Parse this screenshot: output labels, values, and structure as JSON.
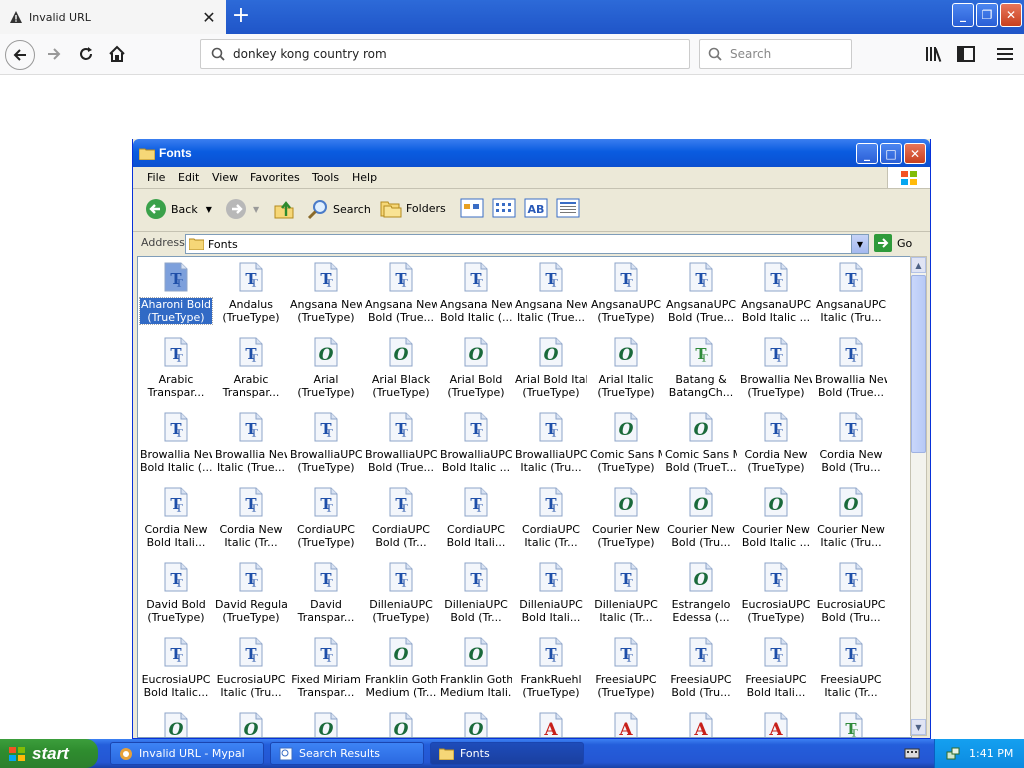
{
  "browser": {
    "tab_title": "Invalid URL",
    "url": "donkey kong country rom",
    "search_placeholder": "Search"
  },
  "explorer": {
    "title": "Fonts",
    "menus": [
      "File",
      "Edit",
      "View",
      "Favorites",
      "Tools",
      "Help"
    ],
    "toolbar": {
      "back": "Back",
      "search": "Search",
      "folders": "Folders"
    },
    "address_label": "Address",
    "address_value": "Fonts",
    "go": "Go",
    "fonts": [
      {
        "n1": "Aharoni Bold",
        "n2": "(TrueType)",
        "t": "T"
      },
      {
        "n1": "Andalus",
        "n2": "(TrueType)",
        "t": "T"
      },
      {
        "n1": "Angsana New",
        "n2": "(TrueType)",
        "t": "T"
      },
      {
        "n1": "Angsana New",
        "n2": "Bold (True...",
        "t": "T"
      },
      {
        "n1": "Angsana New",
        "n2": "Bold Italic (...",
        "t": "T"
      },
      {
        "n1": "Angsana New",
        "n2": "Italic (True...",
        "t": "T"
      },
      {
        "n1": "AngsanaUPC",
        "n2": "(TrueType)",
        "t": "T"
      },
      {
        "n1": "AngsanaUPC",
        "n2": "Bold (True...",
        "t": "T"
      },
      {
        "n1": "AngsanaUPC",
        "n2": "Bold Italic ...",
        "t": "T"
      },
      {
        "n1": "AngsanaUPC",
        "n2": "Italic (Tru...",
        "t": "T"
      },
      {
        "n1": "Arabic",
        "n2": "Transpar...",
        "t": "T"
      },
      {
        "n1": "Arabic",
        "n2": "Transpar...",
        "t": "T"
      },
      {
        "n1": "Arial",
        "n2": "(TrueType)",
        "t": "O"
      },
      {
        "n1": "Arial Black",
        "n2": "(TrueType)",
        "t": "O"
      },
      {
        "n1": "Arial Bold",
        "n2": "(TrueType)",
        "t": "O"
      },
      {
        "n1": "Arial Bold Italic",
        "n2": "(TrueType)",
        "t": "O"
      },
      {
        "n1": "Arial Italic",
        "n2": "(TrueType)",
        "t": "O"
      },
      {
        "n1": "Batang &",
        "n2": "BatangCh...",
        "t": "TG"
      },
      {
        "n1": "Browallia New",
        "n2": "(TrueType)",
        "t": "T"
      },
      {
        "n1": "Browallia New",
        "n2": "Bold (True...",
        "t": "T"
      },
      {
        "n1": "Browallia New",
        "n2": "Bold Italic (...",
        "t": "T"
      },
      {
        "n1": "Browallia New",
        "n2": "Italic (True...",
        "t": "T"
      },
      {
        "n1": "BrowalliaUPC",
        "n2": "(TrueType)",
        "t": "T"
      },
      {
        "n1": "BrowalliaUPC",
        "n2": "Bold (True...",
        "t": "T"
      },
      {
        "n1": "BrowalliaUPC",
        "n2": "Bold Italic ...",
        "t": "T"
      },
      {
        "n1": "BrowalliaUPC",
        "n2": "Italic (Tru...",
        "t": "T"
      },
      {
        "n1": "Comic Sans MS",
        "n2": "(TrueType)",
        "t": "O"
      },
      {
        "n1": "Comic Sans MS",
        "n2": "Bold (TrueT...",
        "t": "O"
      },
      {
        "n1": "Cordia New",
        "n2": "(TrueType)",
        "t": "T"
      },
      {
        "n1": "Cordia New",
        "n2": "Bold (Tru...",
        "t": "T"
      },
      {
        "n1": "Cordia New",
        "n2": "Bold Itali...",
        "t": "T"
      },
      {
        "n1": "Cordia New",
        "n2": "Italic (Tr...",
        "t": "T"
      },
      {
        "n1": "CordiaUPC",
        "n2": "(TrueType)",
        "t": "T"
      },
      {
        "n1": "CordiaUPC",
        "n2": "Bold (Tr...",
        "t": "T"
      },
      {
        "n1": "CordiaUPC",
        "n2": "Bold Itali...",
        "t": "T"
      },
      {
        "n1": "CordiaUPC",
        "n2": "Italic (Tr...",
        "t": "T"
      },
      {
        "n1": "Courier New",
        "n2": "(TrueType)",
        "t": "O"
      },
      {
        "n1": "Courier New",
        "n2": "Bold (Tru...",
        "t": "O"
      },
      {
        "n1": "Courier New",
        "n2": "Bold Italic ...",
        "t": "O"
      },
      {
        "n1": "Courier New",
        "n2": "Italic (Tru...",
        "t": "O"
      },
      {
        "n1": "David Bold",
        "n2": "(TrueType)",
        "t": "T"
      },
      {
        "n1": "David Regular",
        "n2": "(TrueType)",
        "t": "T"
      },
      {
        "n1": "David",
        "n2": "Transpar...",
        "t": "T"
      },
      {
        "n1": "DilleniaUPC",
        "n2": "(TrueType)",
        "t": "T"
      },
      {
        "n1": "DilleniaUPC",
        "n2": "Bold (Tr...",
        "t": "T"
      },
      {
        "n1": "DilleniaUPC",
        "n2": "Bold Itali...",
        "t": "T"
      },
      {
        "n1": "DilleniaUPC",
        "n2": "Italic (Tr...",
        "t": "T"
      },
      {
        "n1": "Estrangelo",
        "n2": "Edessa (...",
        "t": "O"
      },
      {
        "n1": "EucrosiaUPC",
        "n2": "(TrueType)",
        "t": "T"
      },
      {
        "n1": "EucrosiaUPC",
        "n2": "Bold (Tru...",
        "t": "T"
      },
      {
        "n1": "EucrosiaUPC",
        "n2": "Bold Italic...",
        "t": "T"
      },
      {
        "n1": "EucrosiaUPC",
        "n2": "Italic (Tru...",
        "t": "T"
      },
      {
        "n1": "Fixed Miriam",
        "n2": "Transpar...",
        "t": "T"
      },
      {
        "n1": "Franklin Gothic",
        "n2": "Medium (Tr...",
        "t": "O"
      },
      {
        "n1": "Franklin Gothic",
        "n2": "Medium Itali...",
        "t": "O"
      },
      {
        "n1": "FrankRuehl",
        "n2": "(TrueType)",
        "t": "T"
      },
      {
        "n1": "FreesiaUPC",
        "n2": "(TrueType)",
        "t": "T"
      },
      {
        "n1": "FreesiaUPC",
        "n2": "Bold (Tru...",
        "t": "T"
      },
      {
        "n1": "FreesiaUPC",
        "n2": "Bold Itali...",
        "t": "T"
      },
      {
        "n1": "FreesiaUPC",
        "n2": "Italic (Tr...",
        "t": "T"
      },
      {
        "n1": "",
        "n2": "",
        "t": "O"
      },
      {
        "n1": "",
        "n2": "",
        "t": "O"
      },
      {
        "n1": "",
        "n2": "",
        "t": "O"
      },
      {
        "n1": "",
        "n2": "",
        "t": "O"
      },
      {
        "n1": "",
        "n2": "",
        "t": "O"
      },
      {
        "n1": "",
        "n2": "",
        "t": "A"
      },
      {
        "n1": "",
        "n2": "",
        "t": "A"
      },
      {
        "n1": "",
        "n2": "",
        "t": "A"
      },
      {
        "n1": "",
        "n2": "",
        "t": "A"
      },
      {
        "n1": "",
        "n2": "",
        "t": "TG"
      }
    ]
  },
  "taskbar": {
    "start": "start",
    "tasks": [
      "Invalid URL - Mypal",
      "Search Results",
      "Fonts"
    ],
    "clock": "1:41 PM"
  }
}
